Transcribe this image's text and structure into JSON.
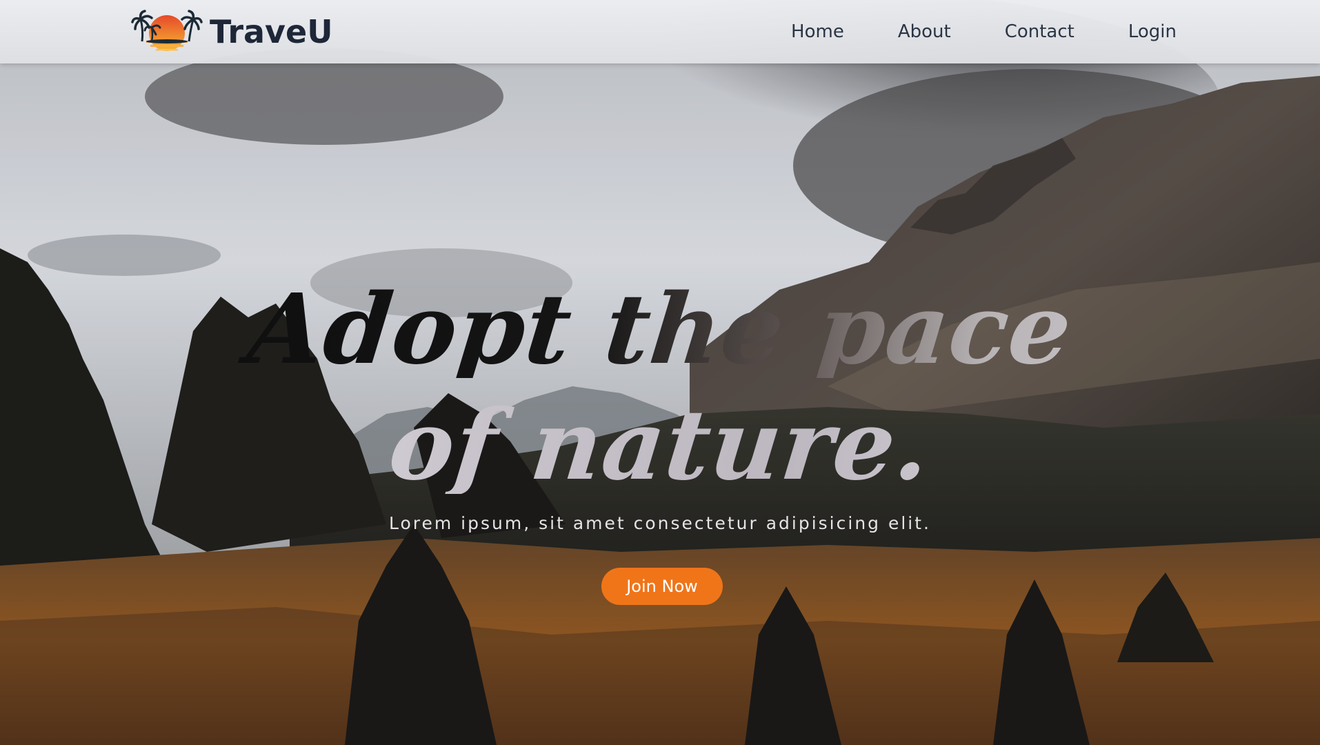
{
  "brand": {
    "name": "TraveU",
    "logo_icon": "island-sunset-logo-icon"
  },
  "nav": {
    "items": [
      {
        "label": "Home"
      },
      {
        "label": "About"
      },
      {
        "label": "Contact"
      },
      {
        "label": "Login"
      }
    ]
  },
  "hero": {
    "headline_line1": "Adopt the pace",
    "headline_line2": "of nature.",
    "subtitle": "Lorem ipsum, sit amet consectetur adipisicing elit.",
    "cta_label": "Join Now",
    "background": "mountain-forest-photo"
  },
  "colors": {
    "accent": "#f07519",
    "brand_text": "#1e2738",
    "nav_text": "#2b3544",
    "header_bg": "#e3e5e9"
  }
}
